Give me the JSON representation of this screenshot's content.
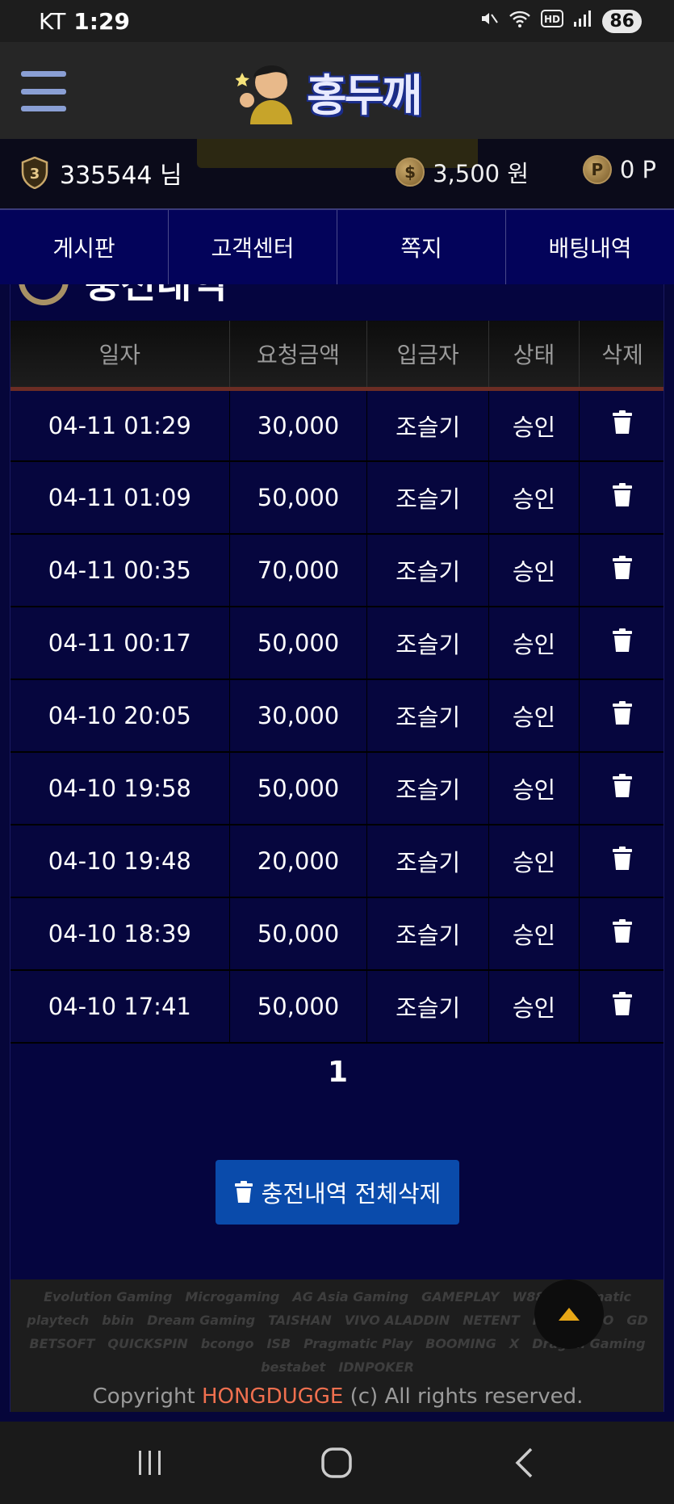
{
  "status_bar": {
    "carrier": "KT",
    "time": "1:29",
    "battery": "86",
    "icons": [
      "mute-icon",
      "wifi-icon",
      "hd-icon",
      "signal-icon"
    ]
  },
  "header": {
    "logo_text": "홍두깨",
    "menu_icon": "hamburger-menu-icon"
  },
  "user": {
    "level": "3",
    "name": "335544 님",
    "money": "3,500 원",
    "money_icon_glyph": "$",
    "points": "0 P",
    "points_icon_glyph": "P"
  },
  "tabs": [
    "게시판",
    "고객센터",
    "쪽지",
    "배팅내역"
  ],
  "section": {
    "title": "충전내역"
  },
  "table": {
    "columns": [
      "일자",
      "요청금액",
      "입금자",
      "상태",
      "삭제"
    ],
    "rows": [
      {
        "date": "04-11 01:29",
        "amount": "30,000",
        "depositor": "조슬기",
        "status": "승인"
      },
      {
        "date": "04-11 01:09",
        "amount": "50,000",
        "depositor": "조슬기",
        "status": "승인"
      },
      {
        "date": "04-11 00:35",
        "amount": "70,000",
        "depositor": "조슬기",
        "status": "승인"
      },
      {
        "date": "04-11 00:17",
        "amount": "50,000",
        "depositor": "조슬기",
        "status": "승인"
      },
      {
        "date": "04-10 20:05",
        "amount": "30,000",
        "depositor": "조슬기",
        "status": "승인"
      },
      {
        "date": "04-10 19:58",
        "amount": "50,000",
        "depositor": "조슬기",
        "status": "승인"
      },
      {
        "date": "04-10 19:48",
        "amount": "20,000",
        "depositor": "조슬기",
        "status": "승인"
      },
      {
        "date": "04-10 18:39",
        "amount": "50,000",
        "depositor": "조슬기",
        "status": "승인"
      },
      {
        "date": "04-10 17:41",
        "amount": "50,000",
        "depositor": "조슬기",
        "status": "승인"
      }
    ]
  },
  "pagination": {
    "current": "1"
  },
  "delete_all_label": "충전내역 전체삭제",
  "footer": {
    "providers": [
      "Evolution Gaming",
      "Microgaming",
      "AG Asia Gaming",
      "GAMEPLAY",
      "W88",
      "Pragmatic",
      "playtech",
      "bbin",
      "Dream Gaming",
      "TAISHAN",
      "VIVO ALADDIN",
      "NETENT",
      "HABANERO",
      "GD",
      "BETSOFT",
      "QUICKSPIN",
      "bcongo",
      "ISB",
      "Pragmatic Play",
      "BOOMING",
      "X",
      "Dragon Gaming",
      "bestabet",
      "IDNPOKER"
    ],
    "copyright_prefix": "Copyright ",
    "copyright_brand": "HONGDUGGE",
    "copyright_suffix": " (c) All rights reserved."
  },
  "colors": {
    "panel_bg": "#05053f",
    "tab_bg": "#03035a",
    "button_blue": "#0a4bab",
    "brand_red": "#f0704f",
    "header_accent": "#6b2d24"
  }
}
